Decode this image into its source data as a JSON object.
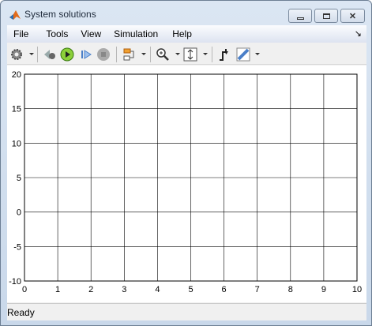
{
  "window": {
    "title": "System solutions",
    "minimize_icon": "minimize-icon",
    "maximize_icon": "maximize-icon",
    "close_icon": "close-icon"
  },
  "menu": {
    "items": [
      "File",
      "Tools",
      "View",
      "Simulation",
      "Help"
    ],
    "dock_icon": "dock-arrow-icon"
  },
  "toolbar": {
    "icons": [
      "gear-icon",
      "step-back-icon",
      "run-icon",
      "step-forward-icon",
      "stop-icon",
      "signal-selector-icon",
      "zoom-in-icon",
      "scale-axes-icon",
      "triggers-icon",
      "measurements-icon"
    ]
  },
  "status": {
    "text": "Ready"
  },
  "chart_data": {
    "type": "line",
    "series": [],
    "xlim": [
      0,
      10
    ],
    "ylim": [
      -10,
      20
    ],
    "xticks": [
      "0",
      "1",
      "2",
      "3",
      "4",
      "5",
      "6",
      "7",
      "8",
      "9",
      "10"
    ],
    "yticks": [
      "-10",
      "-5",
      "0",
      "5",
      "10",
      "15",
      "20"
    ],
    "grid": true,
    "colors": {
      "background": "#ffffff",
      "grid": "#000000"
    }
  }
}
